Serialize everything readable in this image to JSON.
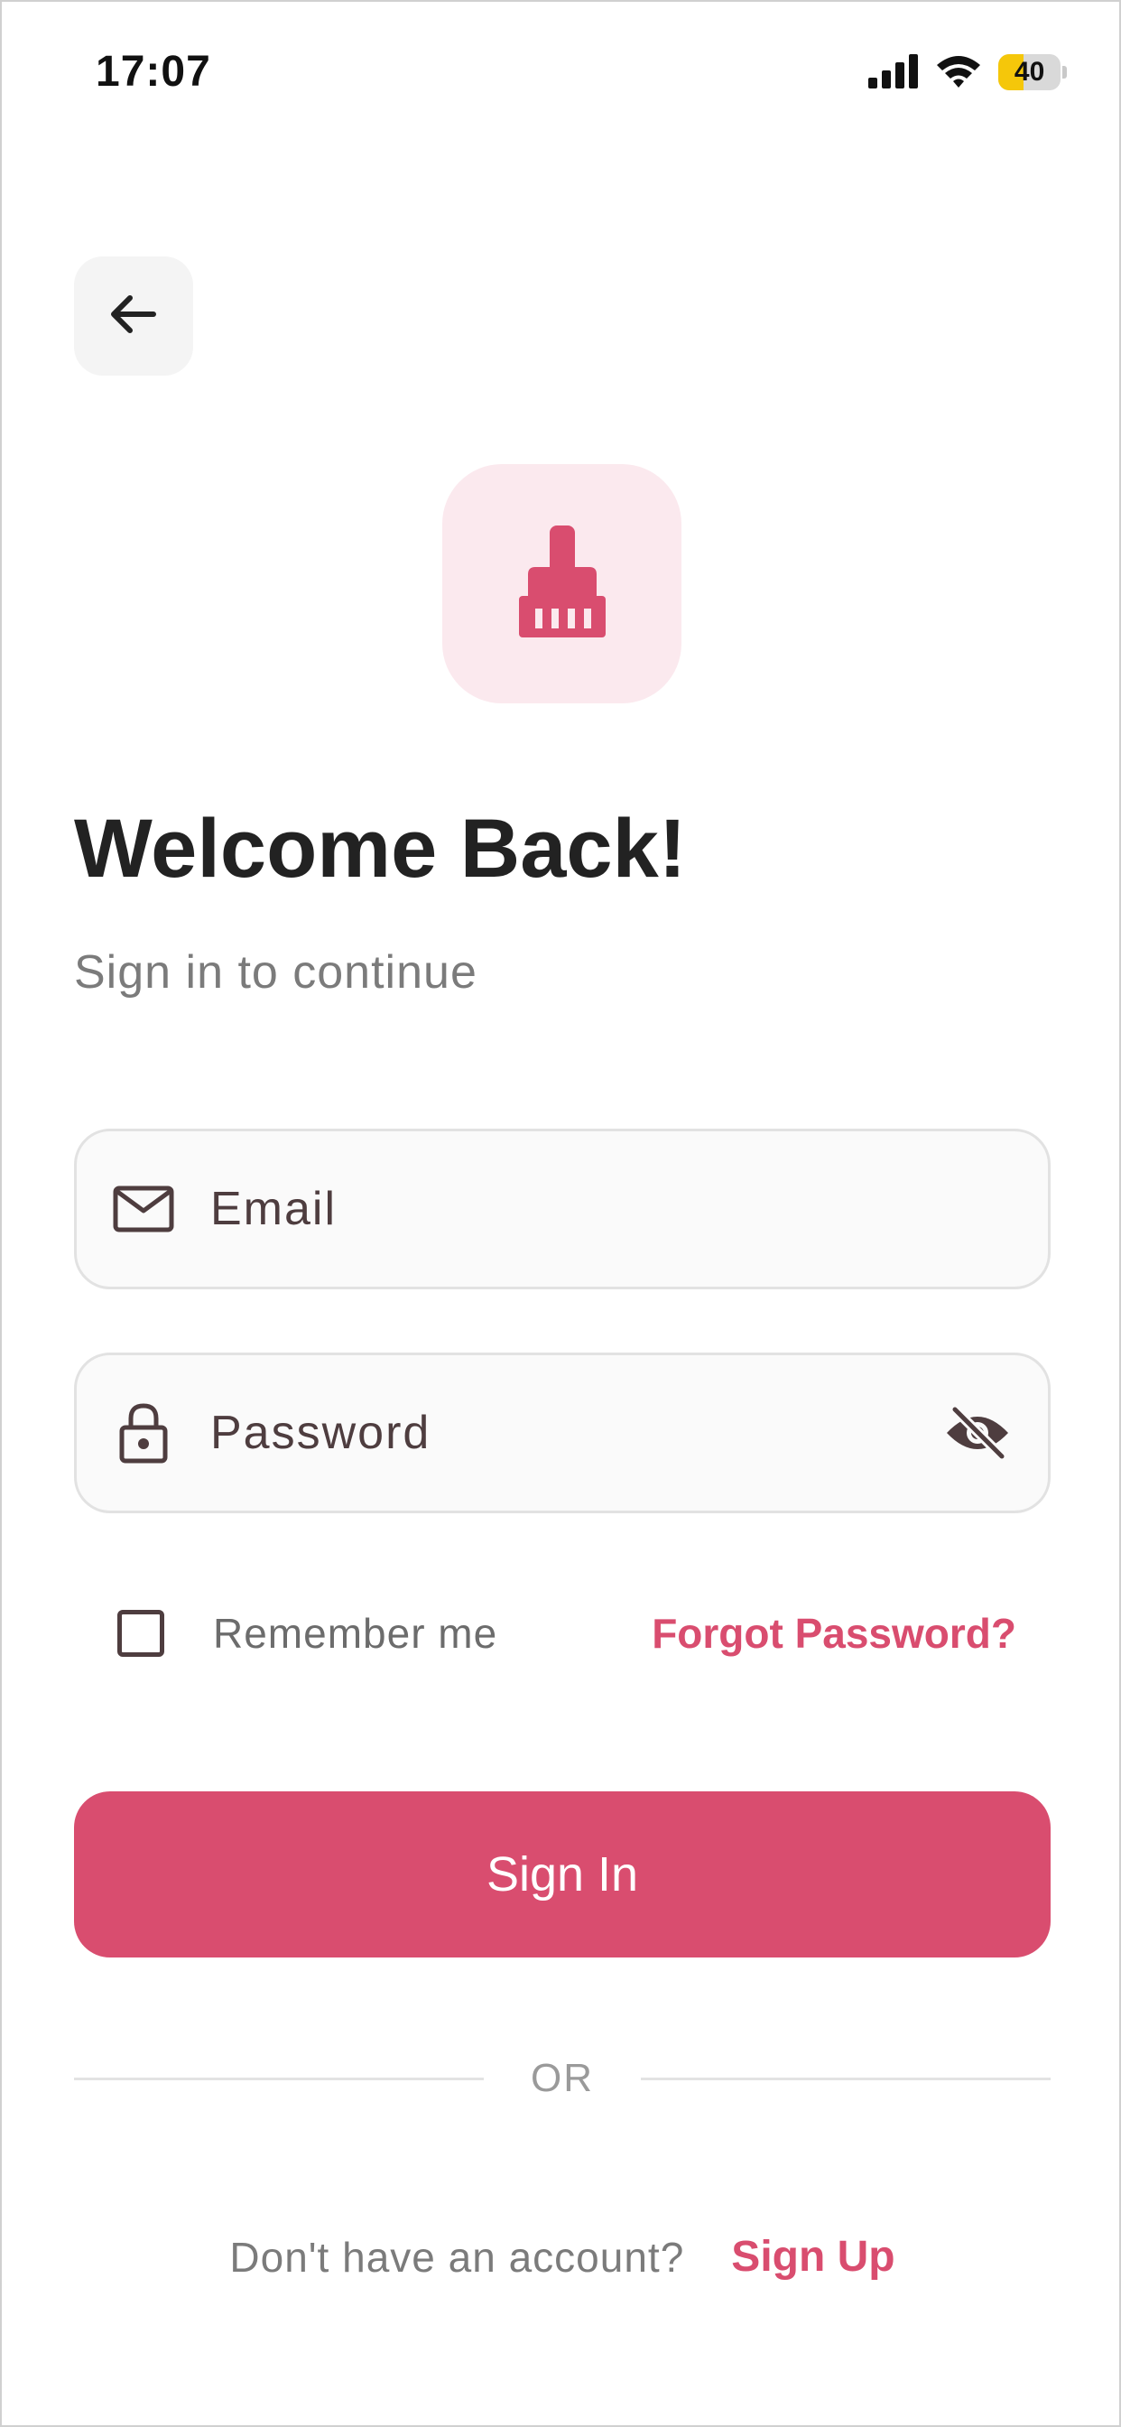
{
  "status_bar": {
    "time": "17:07",
    "battery_level": "40",
    "battery_fraction": 0.4,
    "battery_fill_color": "#f5c70a"
  },
  "header": {
    "back_icon": "arrow-left-icon",
    "logo_icon": "broom-icon"
  },
  "main": {
    "title": "Welcome Back!",
    "subtitle": "Sign in to continue"
  },
  "form": {
    "email": {
      "icon": "mail-icon",
      "placeholder": "Email",
      "value": ""
    },
    "password": {
      "icon": "lock-icon",
      "placeholder": "Password",
      "value": "",
      "toggle_icon": "eye-off-icon"
    },
    "remember_label": "Remember me",
    "remember_checked": false,
    "forgot_label": "Forgot Password?",
    "submit_label": "Sign In",
    "divider_label": "OR"
  },
  "footer": {
    "prompt": "Don't have an account?",
    "signup_label": "Sign Up"
  },
  "colors": {
    "accent": "#d94d6f",
    "accent_light": "#fbe9ee",
    "icon_dark": "#4e3d3f"
  }
}
